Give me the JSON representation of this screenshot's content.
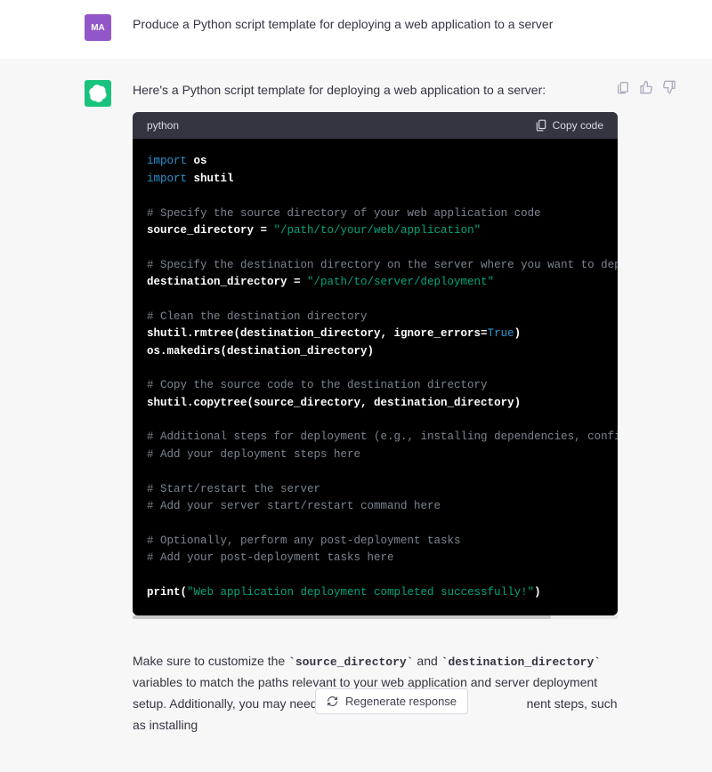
{
  "user": {
    "avatar_text": "MA",
    "message": "Produce a Python script template for deploying a web application to a server"
  },
  "assistant": {
    "intro": "Here's a Python script template for deploying a web application to a server:",
    "code_lang": "python",
    "copy_label": "Copy code",
    "code": {
      "l1": {
        "kw": "import",
        "mod": "os"
      },
      "l2": {
        "kw": "import",
        "mod": "shutil"
      },
      "l3": "# Specify the source directory of your web application code",
      "l4": {
        "var": "source_directory = ",
        "str": "\"/path/to/your/web/application\""
      },
      "l5": "# Specify the destination directory on the server where you want to deploy t",
      "l6": {
        "var": "destination_directory = ",
        "str": "\"/path/to/server/deployment\""
      },
      "l7": "# Clean the destination directory",
      "l8a": "shutil.rmtree(destination_directory, ignore_errors=",
      "l8b": "True",
      "l8c": ")",
      "l9": "os.makedirs(destination_directory)",
      "l10": "# Copy the source code to the destination directory",
      "l11": "shutil.copytree(source_directory, destination_directory)",
      "l12": "# Additional steps for deployment (e.g., installing dependencies, configurin",
      "l13": "# Add your deployment steps here",
      "l14": "# Start/restart the server",
      "l15": "# Add your server start/restart command here",
      "l16": "# Optionally, perform any post-deployment tasks",
      "l17": "# Add your post-deployment tasks here",
      "l18a": "print(",
      "l18b": "\"Web application deployment completed successfully!\"",
      "l18c": ")"
    },
    "followup": {
      "p1a": "Make sure to customize the ",
      "code1": "`source_directory`",
      "p1b": " and ",
      "code2": "`destination_directory`",
      "p1c": " variables to match the paths relevant to your web application and server deployment setup. Additionally, you may need to inclu",
      "p1d": "nent steps, such as installing"
    }
  },
  "actions": {
    "regenerate": "Regenerate response"
  }
}
